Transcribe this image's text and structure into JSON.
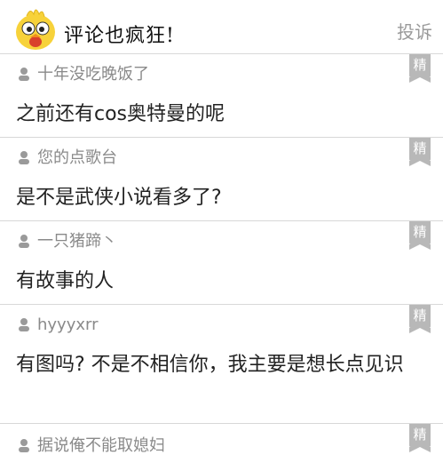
{
  "header": {
    "title": "评论也疯狂!",
    "report_label": "投诉",
    "mascot_icon": "yellow-chick-mascot-icon"
  },
  "badge_label": "精",
  "comments": [
    {
      "user": "十年没吃晚饭了",
      "text": "之前还有cos奥特曼的呢"
    },
    {
      "user": "您的点歌台",
      "text": "是不是武侠小说看多了?"
    },
    {
      "user": "一只猪蹄丶",
      "text": "有故事的人"
    },
    {
      "user": "hyyyxrr",
      "text": "有图吗? 不是不相信你，我主要是想长点见识"
    },
    {
      "user": "据说俺不能取媳妇",
      "text": ""
    }
  ],
  "colors": {
    "badge": "#b8b8b8",
    "meta_text": "#8a8a8a",
    "content_text": "#222222"
  }
}
